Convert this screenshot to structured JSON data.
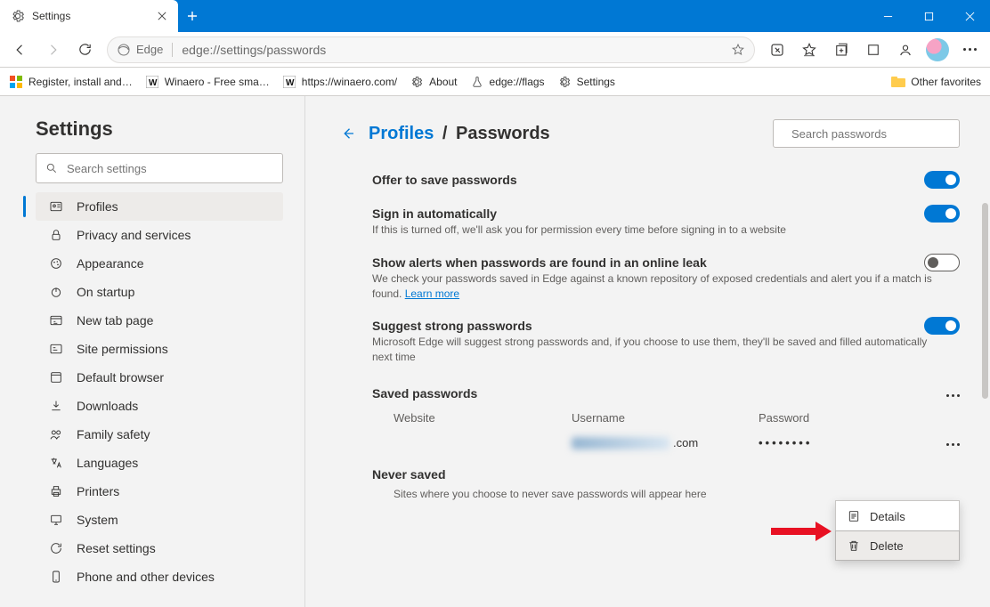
{
  "window": {
    "tab_title": "Settings"
  },
  "omnibox": {
    "brand": "Edge",
    "url": "edge://settings/passwords"
  },
  "bookmarks": {
    "items": [
      "Register, install and…",
      "Winaero - Free sma…",
      "https://winaero.com/",
      "About",
      "edge://flags",
      "Settings"
    ],
    "other": "Other favorites"
  },
  "sidebar": {
    "heading": "Settings",
    "search_placeholder": "Search settings",
    "items": [
      {
        "label": "Profiles"
      },
      {
        "label": "Privacy and services"
      },
      {
        "label": "Appearance"
      },
      {
        "label": "On startup"
      },
      {
        "label": "New tab page"
      },
      {
        "label": "Site permissions"
      },
      {
        "label": "Default browser"
      },
      {
        "label": "Downloads"
      },
      {
        "label": "Family safety"
      },
      {
        "label": "Languages"
      },
      {
        "label": "Printers"
      },
      {
        "label": "System"
      },
      {
        "label": "Reset settings"
      },
      {
        "label": "Phone and other devices"
      }
    ]
  },
  "pane": {
    "crumb_root": "Profiles",
    "crumb_sep": "/",
    "crumb_leaf": "Passwords",
    "search_placeholder": "Search passwords",
    "settings": {
      "offer": {
        "title": "Offer to save passwords"
      },
      "signin": {
        "title": "Sign in automatically",
        "desc": "If this is turned off, we'll ask you for permission every time before signing in to a website"
      },
      "leak": {
        "title": "Show alerts when passwords are found in an online leak",
        "desc": "We check your passwords saved in Edge against a known repository of exposed credentials and alert you if a match is found. ",
        "learn": "Learn more"
      },
      "suggest": {
        "title": "Suggest strong passwords",
        "desc": "Microsoft Edge will suggest strong passwords and, if you choose to use them, they'll be saved and filled automatically next time"
      }
    },
    "saved": {
      "heading": "Saved passwords",
      "cols": {
        "website": "Website",
        "username": "Username",
        "password": "Password"
      },
      "row": {
        "domain_suffix": ".com",
        "password_mask": "••••••••"
      }
    },
    "never": {
      "heading": "Never saved",
      "desc": "Sites where you choose to never save passwords will appear here"
    },
    "menu": {
      "details": "Details",
      "delete": "Delete"
    }
  }
}
